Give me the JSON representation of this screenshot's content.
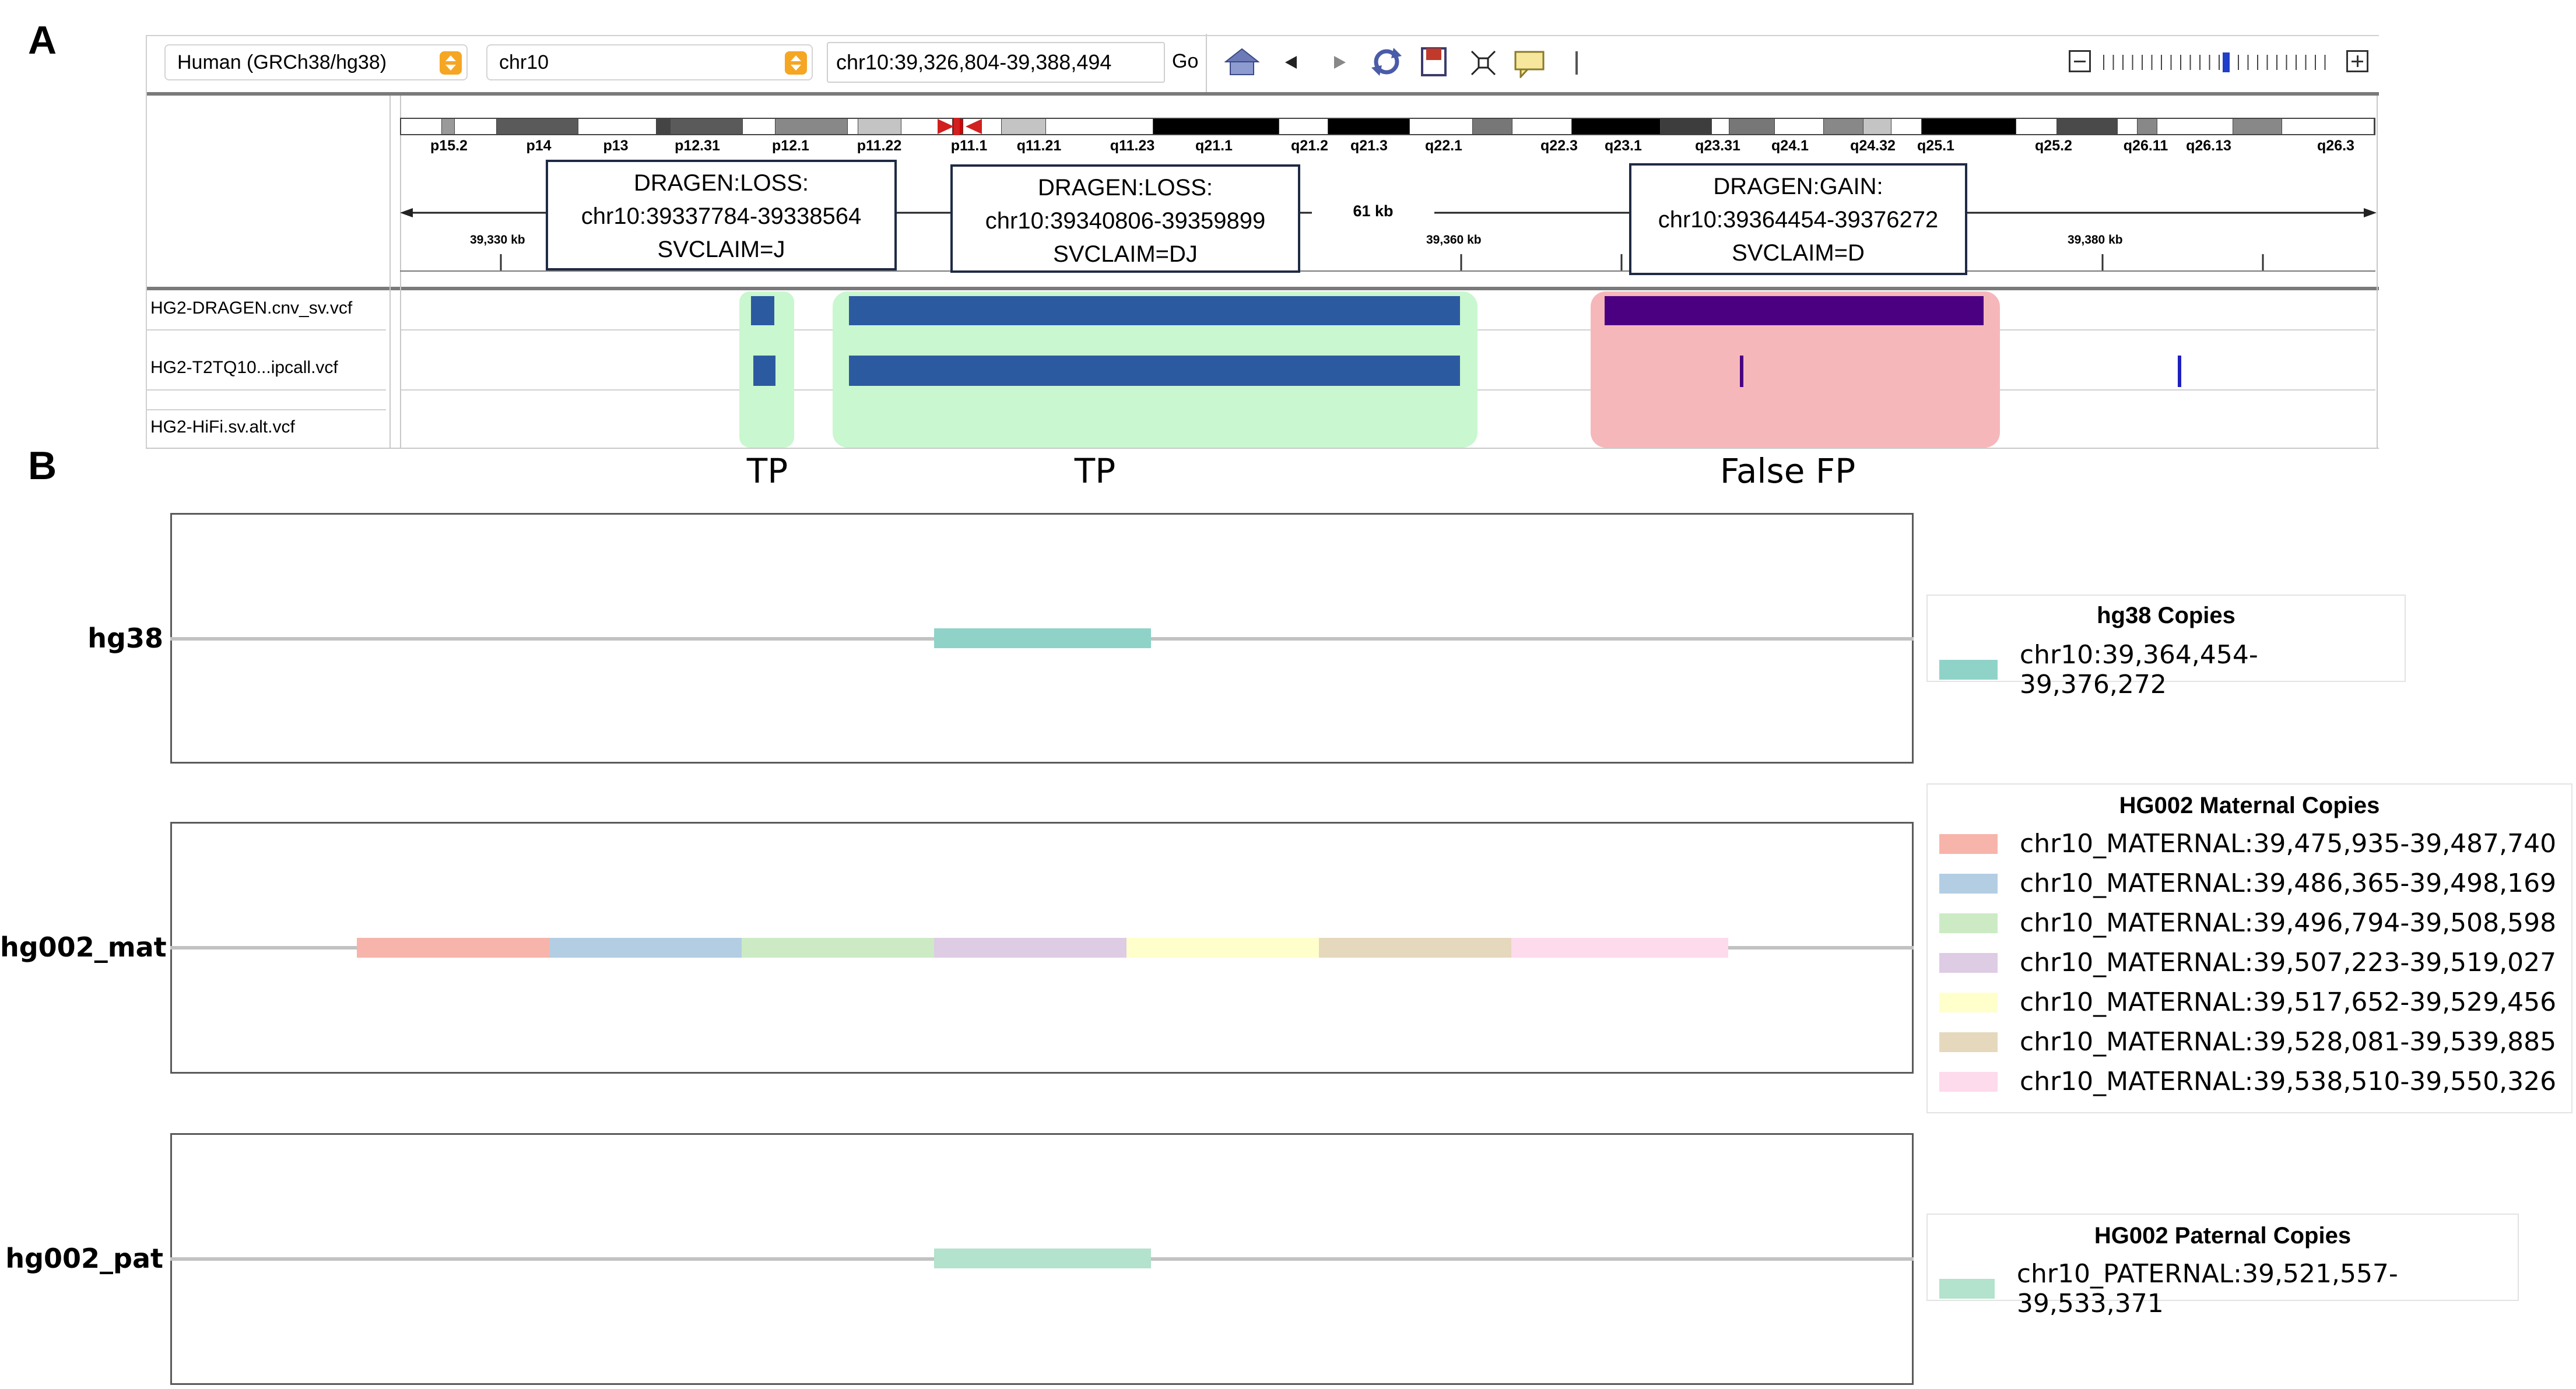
{
  "panel_a": {
    "letter": "A",
    "toolbar": {
      "genome": "Human (GRCh38/hg38)",
      "chromosome": "chr10",
      "locus": "chr10:39,326,804-39,388,494",
      "go_label": "Go"
    },
    "ideogram": {
      "bands": [
        "p15.2",
        "p14",
        "p13",
        "p12.31",
        "p12.1",
        "p11.22",
        "p11.1",
        "q11.21",
        "q11.23",
        "q21.1",
        "q21.2",
        "q21.3",
        "q22.1",
        "q22.3",
        "q23.1",
        "q23.31",
        "q24.1",
        "q24.32",
        "q25.1",
        "q25.2",
        "q26.11",
        "q26.13",
        "q26.3"
      ]
    },
    "ruler": {
      "span_label": "61 kb",
      "ticks": [
        "39,330 kb",
        "39,360 kb",
        "39,380 kb"
      ]
    },
    "callouts": [
      {
        "line1": "DRAGEN:LOSS:",
        "line2": "chr10:39337784-39338564",
        "line3": "SVCLAIM=J"
      },
      {
        "line1": "DRAGEN:LOSS:",
        "line2": "chr10:39340806-39359899",
        "line3": "SVCLAIM=DJ"
      },
      {
        "line1": "DRAGEN:GAIN:",
        "line2": "chr10:39364454-39376272",
        "line3": "SVCLAIM=D"
      }
    ],
    "tracks": [
      "HG2-DRAGEN.cnv_sv.vcf",
      "HG2-T2TQ10...ipcall.vcf",
      "HG2-HiFi.sv.alt.vcf"
    ],
    "classifications": [
      "TP",
      "TP",
      "False FP"
    ],
    "colors": {
      "tp": "#c9f7cf",
      "false_fp": "#f6b7bb",
      "loss": "#2c5aa0",
      "gain": "#4b0082"
    }
  },
  "panel_b": {
    "letter": "B",
    "rows": [
      {
        "label": "hg38"
      },
      {
        "label": "hg002_mat"
      },
      {
        "label": "hg002_pat"
      }
    ],
    "legends": [
      {
        "title": "hg38 Copies",
        "items": [
          {
            "label": "chr10:39,364,454-39,376,272",
            "color": "#8fd3c8"
          }
        ]
      },
      {
        "title": "HG002 Maternal Copies",
        "items": [
          {
            "label": "chr10_MATERNAL:39,475,935-39,487,740",
            "color": "#f7b4aa"
          },
          {
            "label": "chr10_MATERNAL:39,486,365-39,498,169",
            "color": "#b3cde3"
          },
          {
            "label": "chr10_MATERNAL:39,496,794-39,508,598",
            "color": "#ccebc5"
          },
          {
            "label": "chr10_MATERNAL:39,507,223-39,519,027",
            "color": "#decbe4"
          },
          {
            "label": "chr10_MATERNAL:39,517,652-39,529,456",
            "color": "#ffffcc"
          },
          {
            "label": "chr10_MATERNAL:39,528,081-39,539,885",
            "color": "#e5d8bd"
          },
          {
            "label": "chr10_MATERNAL:39,538,510-39,550,326",
            "color": "#fddaec"
          }
        ]
      },
      {
        "title": "HG002 Paternal Copies",
        "items": [
          {
            "label": "chr10_PATERNAL:39,521,557-39,533,371",
            "color": "#b3e2cd"
          }
        ]
      }
    ]
  }
}
